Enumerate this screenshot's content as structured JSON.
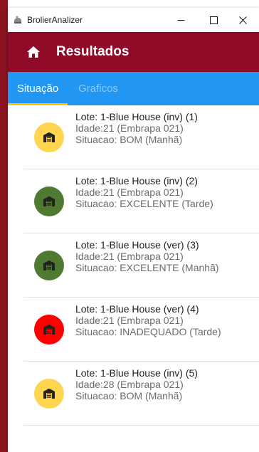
{
  "window": {
    "title": "BrolierAnalizer",
    "controls": {
      "minimize": "minimize-icon",
      "maximize": "maximize-icon",
      "close": "close-icon"
    }
  },
  "appbar": {
    "title": "Resultados",
    "icon": "home-icon"
  },
  "tabs": [
    {
      "label": "Situação",
      "active": true
    },
    {
      "label": "Graficos",
      "active": false
    }
  ],
  "colors": {
    "appbar": "#8e0a26",
    "tabbar": "#2196f3",
    "tab_indicator": "#ffc107",
    "status_bom": "#ffd54f",
    "status_excelente": "#4e7a32",
    "status_inadequado": "#ff0000"
  },
  "items": [
    {
      "line1": "Lote: 1-Blue House (inv) (1)",
      "line2": "Idade:21 (Embrapa 021)",
      "line3": "Situacao: BOM (Manhã)",
      "status": "bom",
      "color": "#ffd54f",
      "icon": "warehouse-icon"
    },
    {
      "line1": "Lote: 1-Blue House (inv) (2)",
      "line2": "Idade:21 (Embrapa 021)",
      "line3": "Situacao: EXCELENTE (Tarde)",
      "status": "excelente",
      "color": "#4e7a32",
      "icon": "warehouse-icon"
    },
    {
      "line1": "Lote: 1-Blue House (ver) (3)",
      "line2": "Idade:21 (Embrapa 021)",
      "line3": "Situacao: EXCELENTE (Manhã)",
      "status": "excelente",
      "color": "#4e7a32",
      "icon": "warehouse-icon"
    },
    {
      "line1": "Lote: 1-Blue House (ver) (4)",
      "line2": "Idade:21 (Embrapa 021)",
      "line3": "Situacao: INADEQUADO (Tarde)",
      "status": "inadequado",
      "color": "#ff0000",
      "icon": "warehouse-icon"
    },
    {
      "line1": "Lote: 1-Blue House (inv) (5)",
      "line2": "Idade:28 (Embrapa 021)",
      "line3": "Situacao: BOM (Manhã)",
      "status": "bom",
      "color": "#ffd54f",
      "icon": "warehouse-icon"
    }
  ]
}
